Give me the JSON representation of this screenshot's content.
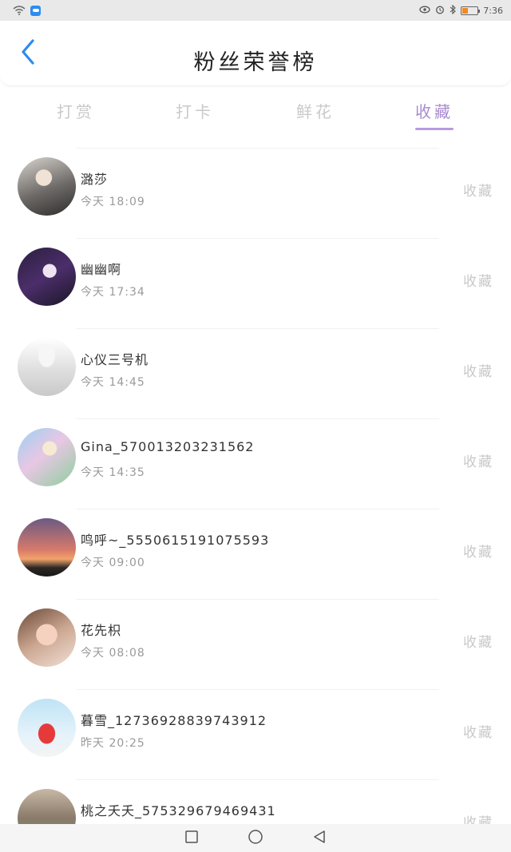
{
  "status_bar": {
    "time": "7:36"
  },
  "header": {
    "title": "粉丝荣誉榜"
  },
  "tabs": [
    {
      "label": "打赏"
    },
    {
      "label": "打卡"
    },
    {
      "label": "鲜花"
    },
    {
      "label": "收藏",
      "active": true
    }
  ],
  "list": [
    {
      "name": "潞莎",
      "time": "今天 18:09",
      "action": "收藏"
    },
    {
      "name": "幽幽啊",
      "time": "今天 17:34",
      "action": "收藏"
    },
    {
      "name": "心仪三号机",
      "time": "今天 14:45",
      "action": "收藏"
    },
    {
      "name": "Gina_570013203231562",
      "time": "今天 14:35",
      "action": "收藏"
    },
    {
      "name": "鸣呼~_5550615191075593",
      "time": "今天 09:00",
      "action": "收藏"
    },
    {
      "name": "花先枳",
      "time": "今天 08:08",
      "action": "收藏"
    },
    {
      "name": "暮雪_12736928839743912",
      "time": "昨天 20:25",
      "action": "收藏"
    },
    {
      "name": "桃之夭夭_575329679469431",
      "time": "",
      "action": "收藏"
    }
  ],
  "colors": {
    "accent": "#b89ae0",
    "back_arrow": "#2d8cf0",
    "inactive_tab": "#c9c9c9"
  },
  "icons": [
    "wifi-icon",
    "cloud-icon",
    "eye-icon",
    "alarm-icon",
    "bluetooth-icon",
    "battery-icon",
    "back-arrow-icon",
    "square-nav-icon",
    "circle-nav-icon",
    "triangle-nav-icon"
  ]
}
